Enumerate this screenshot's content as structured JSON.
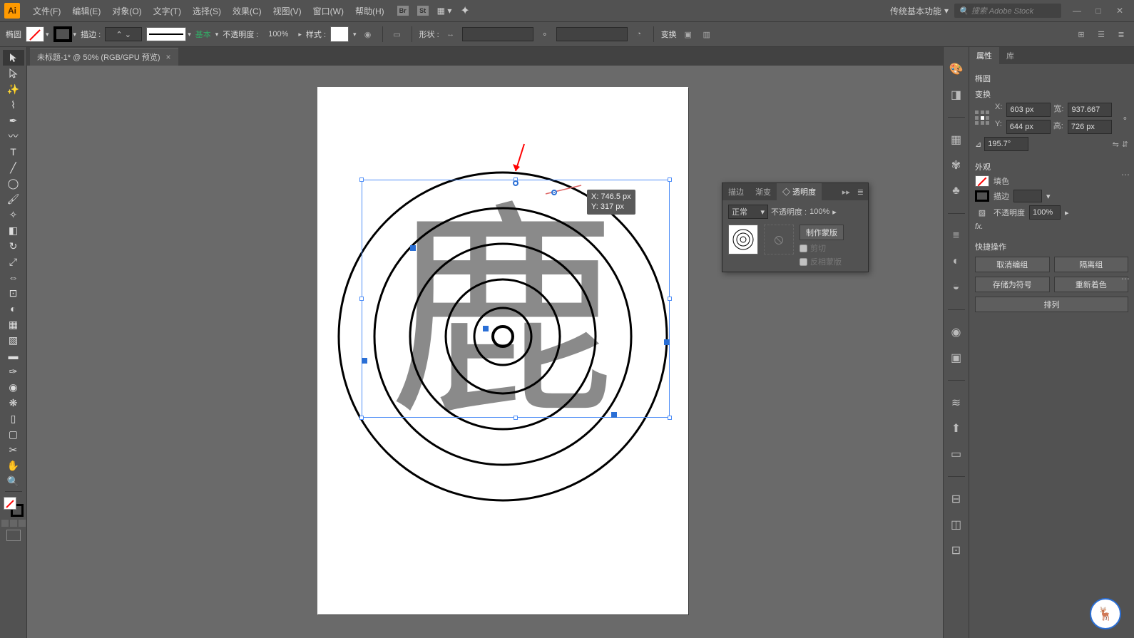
{
  "app": {
    "logo": "Ai"
  },
  "menu": [
    "文件(F)",
    "编辑(E)",
    "对象(O)",
    "文字(T)",
    "选择(S)",
    "效果(C)",
    "视图(V)",
    "窗口(W)",
    "帮助(H)"
  ],
  "workspace": "传统基本功能",
  "search_placeholder": "搜索 Adobe Stock",
  "control": {
    "tool_name": "椭圆",
    "stroke_label": "描边 :",
    "stroke_style": "基本",
    "opacity_label": "不透明度 :",
    "opacity_value": "100%",
    "style_label": "样式 :",
    "shape_label": "形状 :",
    "transform_label": "变换"
  },
  "tab": {
    "title": "未标题-1* @ 50% (RGB/GPU 预览)"
  },
  "tooltip": {
    "x": "X: 746.5 px",
    "y": "Y: 317 px"
  },
  "panels": {
    "properties_tab": "属性",
    "library_tab": "库",
    "object_type": "椭圆",
    "transform_title": "变换",
    "x_label": "X:",
    "x_value": "603 px",
    "y_label": "Y:",
    "y_value": "644 px",
    "w_label": "宽:",
    "w_value": "937.667",
    "h_label": "高:",
    "h_value": "726 px",
    "angle_value": "195.7°",
    "appearance_title": "外观",
    "fill_label": "填色",
    "stroke_label": "描边",
    "opacity_label": "不透明度",
    "opacity_value": "100%",
    "fx_label": "fx.",
    "quick_title": "快捷操作",
    "qa": [
      "取消编组",
      "隔离组",
      "存储为符号",
      "重新着色",
      "排列"
    ]
  },
  "transparency_panel": {
    "tabs": [
      "描边",
      "渐变",
      "◇ 透明度"
    ],
    "mode": "正常",
    "opacity_label": "不透明度 :",
    "opacity_value": "100%",
    "make_mask": "制作蒙版",
    "clip": "剪切",
    "invert": "反相蒙版"
  }
}
